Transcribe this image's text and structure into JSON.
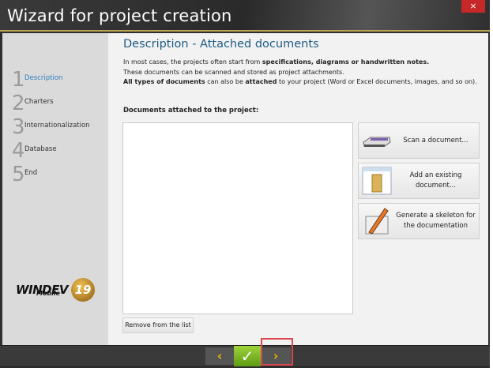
{
  "window": {
    "title": "Wizard for project creation",
    "close_label": "×"
  },
  "sidebar": {
    "steps": [
      {
        "num": "1",
        "label": "Description"
      },
      {
        "num": "2",
        "label": "Charters"
      },
      {
        "num": "3",
        "label": "Internationalization"
      },
      {
        "num": "4",
        "label": "Database"
      },
      {
        "num": "5",
        "label": "End"
      }
    ],
    "logo": {
      "brand": "WINDEV",
      "sub": "Mobile",
      "version": "19"
    }
  },
  "main": {
    "heading": "Description - Attached documents",
    "intro": {
      "l1_a": "In most cases, the projects often start from ",
      "l1_b": "specifications, diagrams or handwritten notes.",
      "l2": "These documents can be scanned and stored as project attachments.",
      "l3_a": "All types of documents",
      "l3_b": " can also be ",
      "l3_c": "attached",
      "l3_d": " to your project (Word or Excel documents, images, and so on)."
    },
    "documents_label": "Documents attached to the project:",
    "actions": [
      {
        "label": "Scan a document...",
        "icon": "scanner-icon"
      },
      {
        "label": "Add an existing document...",
        "icon": "folder-icon"
      },
      {
        "label": "Generate a skeleton for the documentation",
        "icon": "pencil-icon"
      }
    ],
    "remove_label": "Remove from the list"
  },
  "footer": {
    "prev": "‹",
    "ok": "✓",
    "next": "›"
  }
}
